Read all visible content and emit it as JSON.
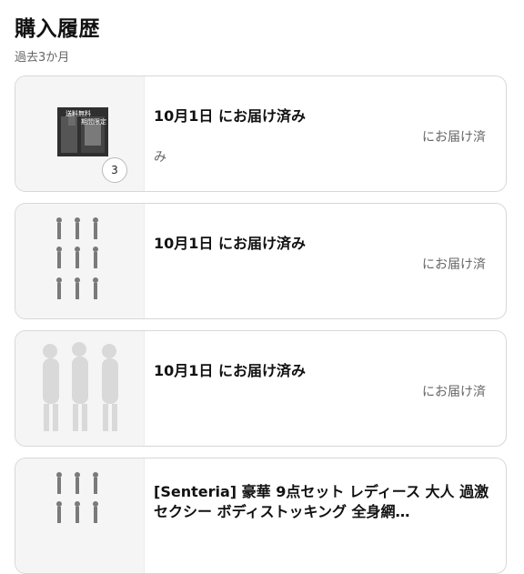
{
  "header": {
    "title": "購入履歴",
    "subtitle": "過去3か月"
  },
  "orders": [
    {
      "title": "10月1日 にお届け済み",
      "status_line1": "にお届け済",
      "status_line2": "み",
      "qty": "3"
    },
    {
      "title": "10月1日 にお届け済み",
      "status_line1": "にお届け済"
    },
    {
      "title": "10月1日 にお届け済み",
      "status_line1": "にお届け済"
    },
    {
      "title": "[Senteria] 豪華 9点セット レディース 大人 過激 セクシー ボディストッキング 全身網…"
    }
  ],
  "thumb_text": {
    "line1": "送料無料",
    "line2": "期間限定"
  },
  "colors": {
    "card_border": "#d8d8d8",
    "thumb_bg": "#f5f5f5",
    "muted_text": "#666666"
  }
}
